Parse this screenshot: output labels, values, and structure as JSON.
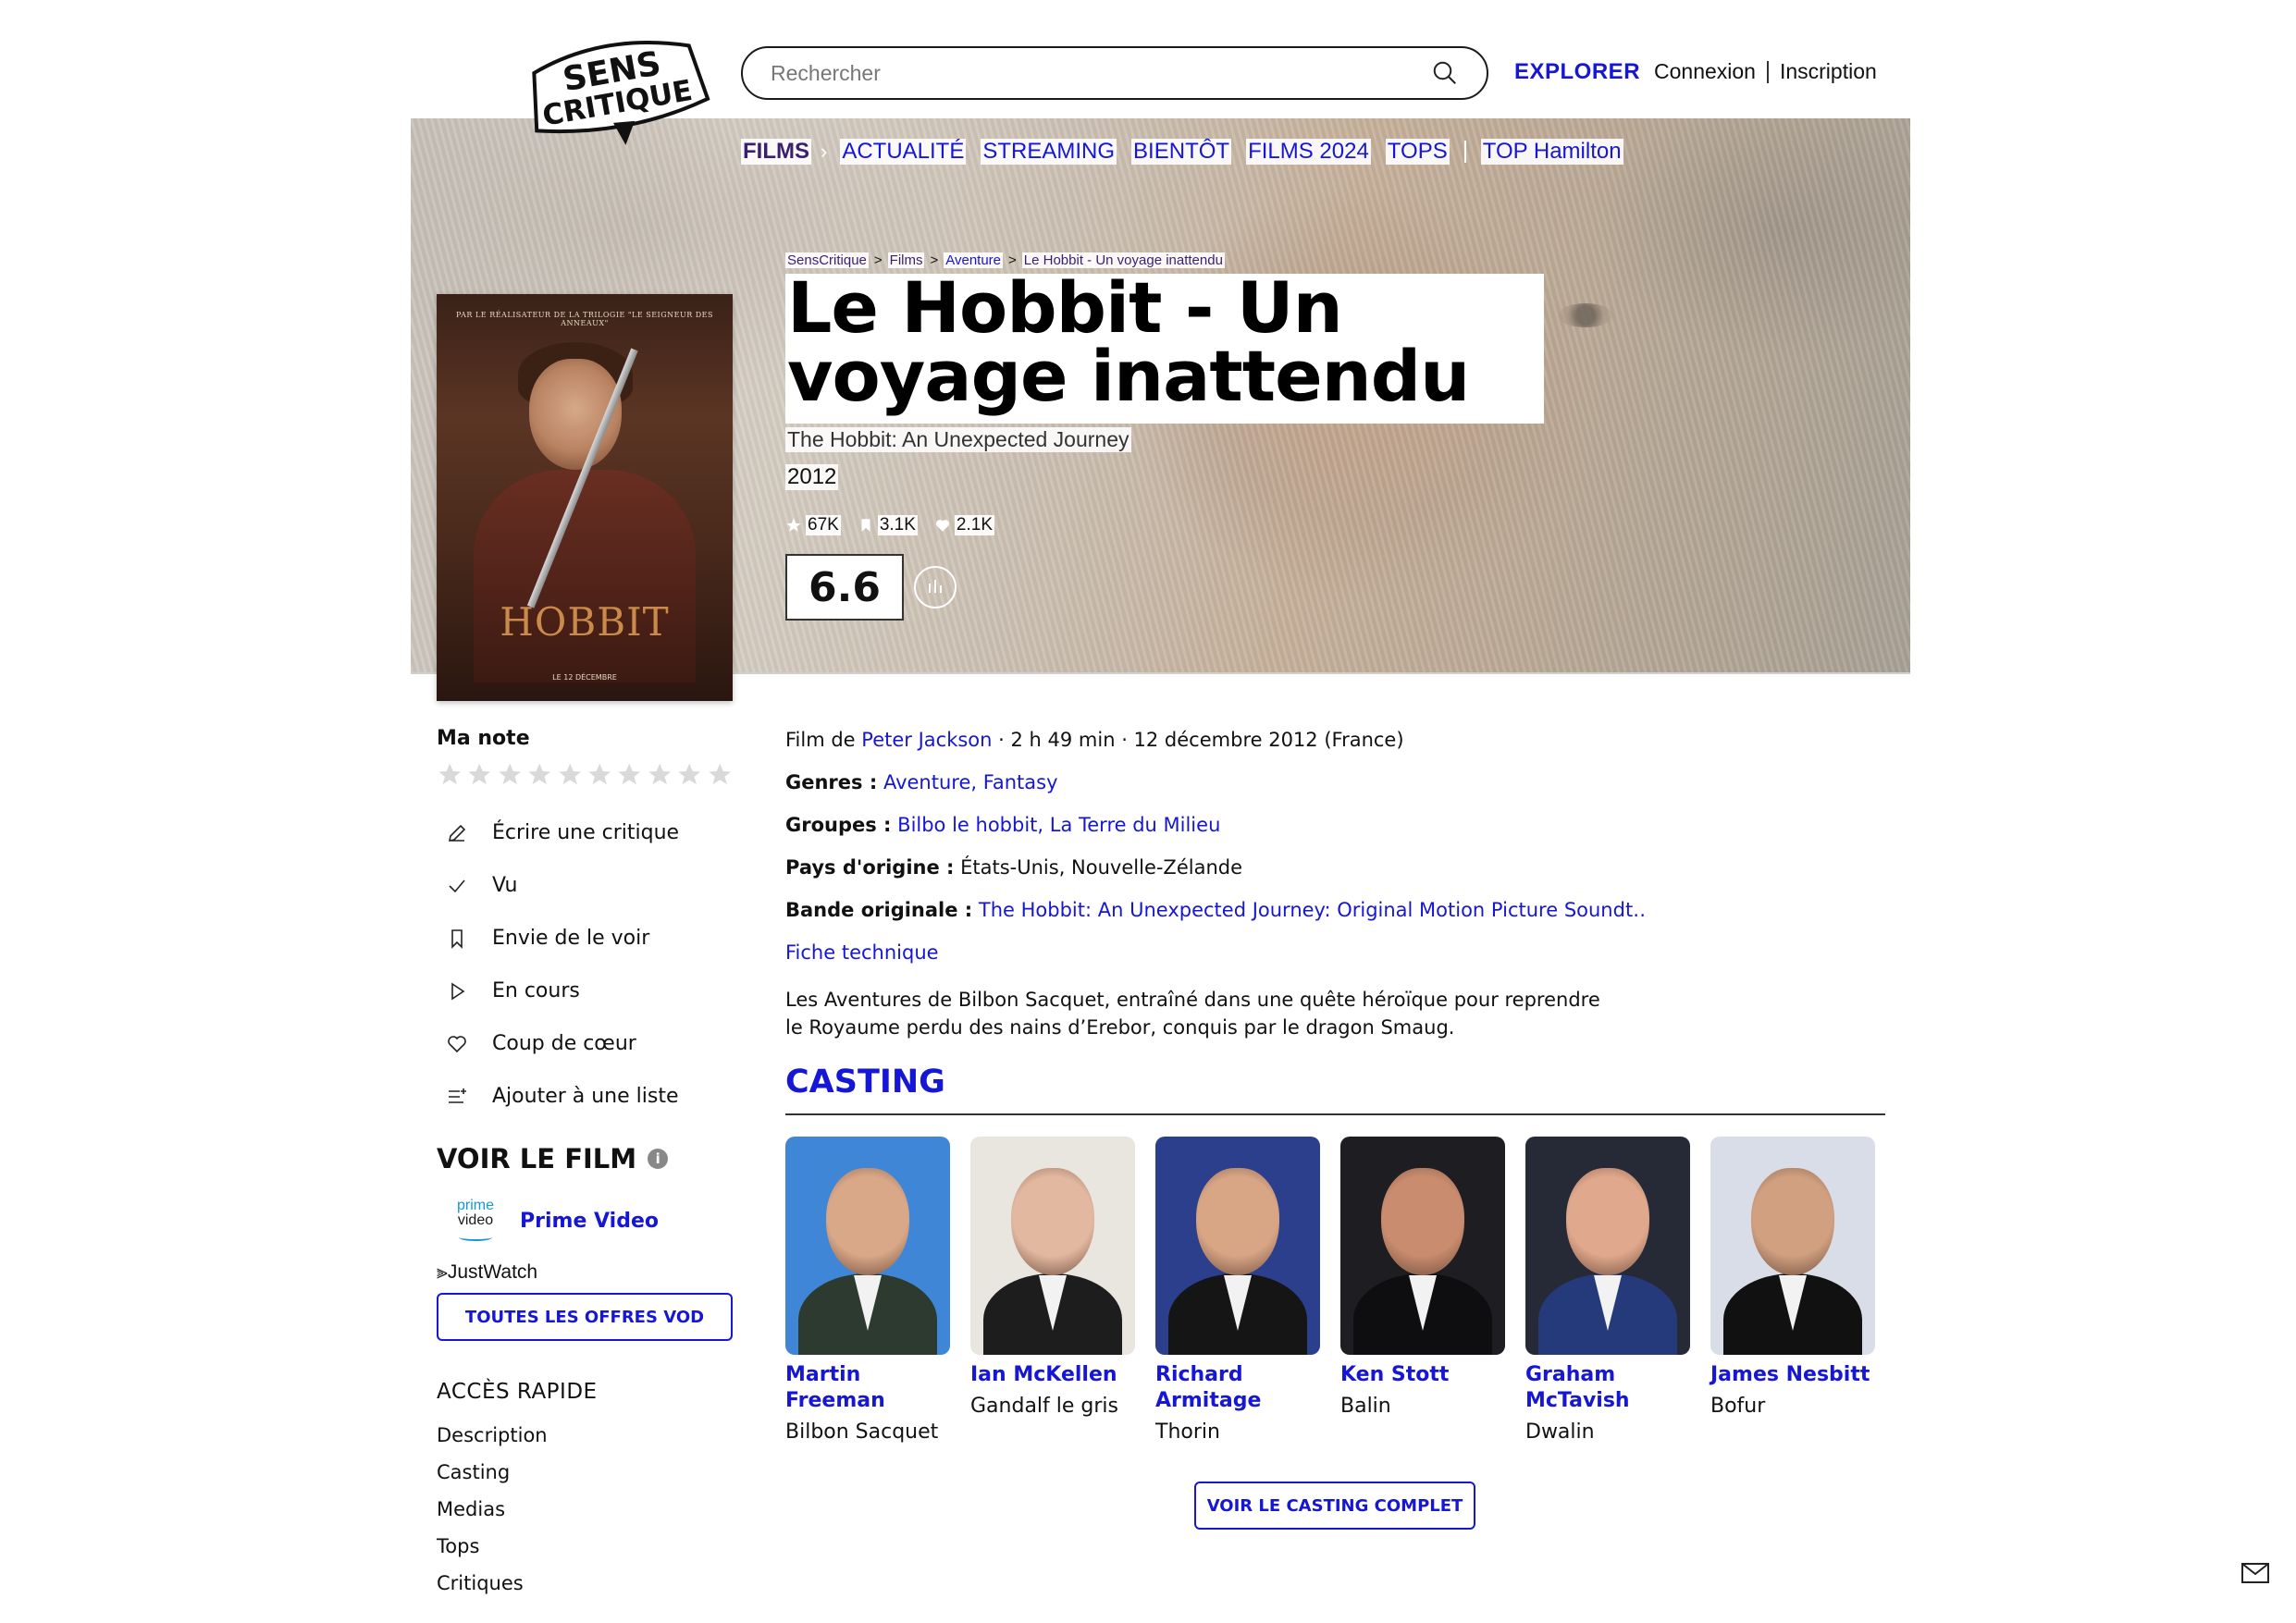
{
  "header": {
    "logo_line1": "SENS",
    "logo_line2": "CRITIQUE",
    "search_placeholder": "Rechercher",
    "explorer": "EXPLORER",
    "login": "Connexion",
    "signup": "Inscription"
  },
  "nav": {
    "films": "FILMS",
    "items": [
      "ACTUALITÉ",
      "STREAMING",
      "BIENTÔT",
      "FILMS 2024",
      "TOPS"
    ],
    "top_link": "TOP Hamilton"
  },
  "breadcrumb": [
    "SensCritique",
    "Films",
    "Aventure",
    "Le Hobbit - Un voyage inattendu"
  ],
  "movie": {
    "title": "Le Hobbit - Un voyage inattendu",
    "original_title": "The Hobbit: An Unexpected Journey",
    "year": "2012",
    "stats": {
      "ratings": "67K",
      "wishlist": "3.1K",
      "favorites": "2.1K"
    },
    "score": "6.6",
    "poster": {
      "tagline": "PAR LE RÉALISATEUR DE LA TRILOGIE \"LE SEIGNEUR DES ANNEAUX\"",
      "title": "HOBBIT",
      "release": "LE 12 DÉCEMBRE"
    }
  },
  "sidebar": {
    "my_rating": "Ma note",
    "actions": [
      {
        "label": "Écrire une critique",
        "icon": "pencil-icon"
      },
      {
        "label": "Vu",
        "icon": "check-icon"
      },
      {
        "label": "Envie de le voir",
        "icon": "bookmark-icon"
      },
      {
        "label": "En cours",
        "icon": "play-icon"
      },
      {
        "label": "Coup de cœur",
        "icon": "heart-icon"
      },
      {
        "label": "Ajouter à une liste",
        "icon": "list-add-icon"
      }
    ],
    "watch_title": "VOIR LE FILM",
    "provider_logo_top": "prime",
    "provider_logo_bottom": "video",
    "provider": "Prime Video",
    "justwatch": "JustWatch",
    "vod_button": "TOUTES LES OFFRES VOD",
    "quick_access_title": "ACCÈS RAPIDE",
    "quick_access": [
      "Description",
      "Casting",
      "Medias",
      "Tops",
      "Critiques"
    ]
  },
  "details": {
    "film_de": "Film de",
    "director": "Peter Jackson",
    "duration_date": " · 2 h 49 min · 12 décembre 2012 (France)",
    "genres_label": "Genres :",
    "genres": "Aventure, Fantasy",
    "groups_label": "Groupes :",
    "groups": "Bilbo le hobbit, La Terre du Milieu",
    "country_label": "Pays d'origine :",
    "country": "États-Unis, Nouvelle-Zélande",
    "soundtrack_label": "Bande originale :",
    "soundtrack": "The Hobbit: An Unexpected Journey: Original Motion Picture Soundt…",
    "technical": "Fiche technique",
    "synopsis": "Les Aventures de Bilbon Sacquet, entraîné dans une quête héroïque pour reprendre le Royaume perdu des nains d’Erebor, conquis par le dragon Smaug."
  },
  "casting": {
    "title": "CASTING",
    "members": [
      {
        "name": "Martin Freeman",
        "role": "Bilbon Sacquet",
        "bg": "#3f86d6",
        "skin": "#d9a888",
        "suit": "#2c3a30"
      },
      {
        "name": "Ian McKellen",
        "role": "Gandalf le gris",
        "bg": "#e9e6e0",
        "skin": "#e3b8a0",
        "suit": "#1d1d1d"
      },
      {
        "name": "Richard Armitage",
        "role": "Thorin",
        "bg": "#2c3f8c",
        "skin": "#d8a585",
        "suit": "#151515"
      },
      {
        "name": "Ken Stott",
        "role": "Balin",
        "bg": "#1d1d22",
        "skin": "#c98c6e",
        "suit": "#0e0e10"
      },
      {
        "name": "Graham McTavish",
        "role": "Dwalin",
        "bg": "#262a36",
        "skin": "#e0a88c",
        "suit": "#253a7a"
      },
      {
        "name": "James Nesbitt",
        "role": "Bofur",
        "bg": "#d9dde8",
        "skin": "#d0a080",
        "suit": "#111111"
      }
    ],
    "full_button": "VOIR LE CASTING COMPLET"
  }
}
